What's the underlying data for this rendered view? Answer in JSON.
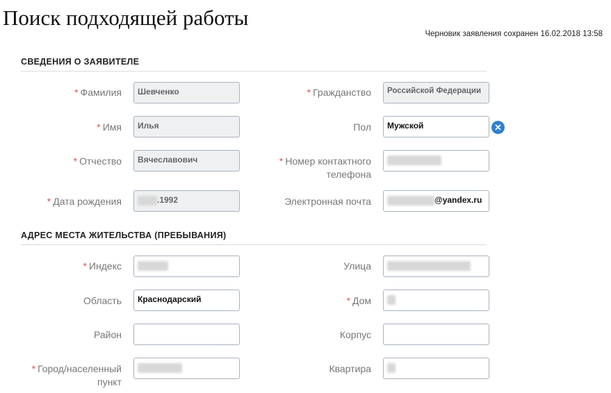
{
  "page": {
    "title": "Поиск подходящей работы",
    "draft_status": "Черновик заявления сохранен 16.02.2018 13:58"
  },
  "applicant": {
    "section_title": "СВЕДЕНИЯ О ЗАЯВИТЕЛЕ",
    "surname": {
      "label": "Фамилия",
      "required": true,
      "value": "Шевченко"
    },
    "name": {
      "label": "Имя",
      "required": true,
      "value": "Илья"
    },
    "patronymic": {
      "label": "Отчество",
      "required": true,
      "value": "Вячеславович"
    },
    "birth_date": {
      "label": "Дата рождения",
      "required": true,
      "value": ".1992"
    },
    "citizenship": {
      "label": "Гражданство",
      "required": true,
      "value": "Российской Федерации"
    },
    "gender": {
      "label": "Пол",
      "required": false,
      "value": "Мужской"
    },
    "phone": {
      "label_line1": "Номер контактного",
      "label_line2": "телефона",
      "required": true,
      "value": ""
    },
    "email": {
      "label": "Электронная почта",
      "required": false,
      "value": "@yandex.ru"
    }
  },
  "address": {
    "section_title": "АДРЕС МЕСТА ЖИТЕЛЬСТВА (ПРЕБЫВАНИЯ)",
    "index": {
      "label": "Индекс",
      "required": true,
      "value": ""
    },
    "region": {
      "label": "Область",
      "required": false,
      "value": "Краснодарский"
    },
    "district": {
      "label": "Район",
      "required": false,
      "value": ""
    },
    "city": {
      "label_line1": "Город/населенный",
      "label_line2": "пункт",
      "required": true,
      "value": ""
    },
    "street": {
      "label": "Улица",
      "required": false,
      "value": ""
    },
    "house": {
      "label": "Дом",
      "required": true,
      "value": ""
    },
    "building": {
      "label": "Корпус",
      "required": false,
      "value": ""
    },
    "apartment": {
      "label": "Квартира",
      "required": false,
      "value": ""
    }
  },
  "icons": {
    "clear_gender": "close-icon"
  },
  "colors": {
    "required_marker": "#e05050",
    "clear_button": "#2f7fd0",
    "readonly_bg": "#eef0f2"
  }
}
